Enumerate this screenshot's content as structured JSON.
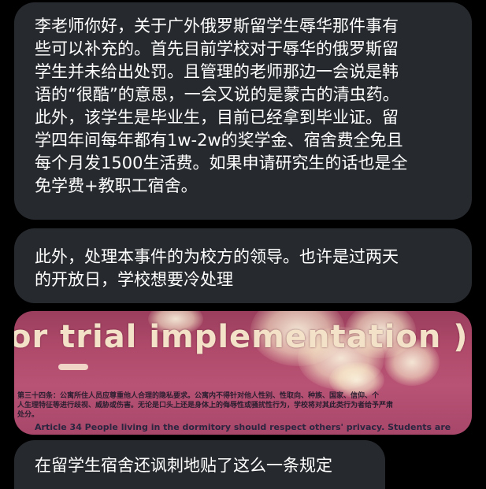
{
  "messages": [
    {
      "lines": [
        "李老师你好，关于广外俄罗斯留学生辱华那件事有",
        "些可以补充的。首先目前学校对于辱华的俄罗斯留",
        "学生并未给出处罚。且管理的老师那边一会说是韩",
        "语的“很酷”的意思，一会又说的是蒙古的清虫药。",
        "此外，该学生是毕业生，目前已经拿到毕业证。留",
        "学四年间每年都有1w-2w的奖学金、宿舍费全免且",
        "每个月发1500生活费。如果申请研究生的话也是全",
        "免学费+教职工宿舍。"
      ]
    },
    {
      "lines": [
        "此外，处理本事件的为校方的领导。也许是过两天",
        "的开放日，学校想要冷处理"
      ]
    },
    {
      "lines": [
        "在留学生宿舍还讽刺地贴了这么一条规定"
      ]
    }
  ],
  "photo": {
    "title": "or trial implementation )",
    "rule_cn_lines": [
      "第三十四条：公寓所住人员应尊重他人合理的隐私要求。公寓内不得针对他人性别、性取向、种族、国家、信仰、个",
      "人生理特征等进行歧视、威胁或伤害。无论是口头上还是身体上的侮辱性或骚扰性行为，学校将对其此类行为者给予严肃",
      "处分。"
    ],
    "rule_en": "Article 34   People living in the dormitory should respect others'   privacy. Students are",
    "background_color": "#b04a6b"
  },
  "colors": {
    "background": "#000000",
    "bubble": "#26292e",
    "text": "#ffffff"
  }
}
